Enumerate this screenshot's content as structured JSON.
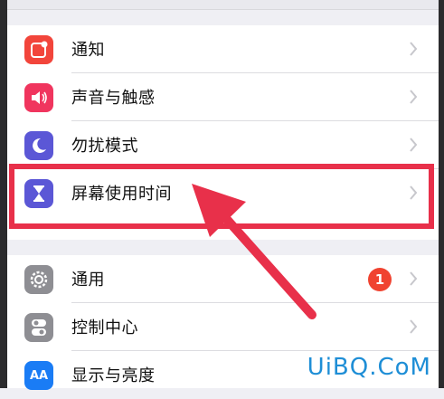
{
  "settings": {
    "group1": [
      {
        "label": "通知",
        "icon": "notifications-icon",
        "color": "#f2453b"
      },
      {
        "label": "声音与触感",
        "icon": "sound-icon",
        "color": "#f0355e"
      },
      {
        "label": "勿扰模式",
        "icon": "moon-icon",
        "color": "#5b57d6"
      },
      {
        "label": "屏幕使用时间",
        "icon": "hourglass-icon",
        "color": "#5b57d6"
      }
    ],
    "group2": [
      {
        "label": "通用",
        "icon": "gear-icon",
        "color": "#8e8e93",
        "badge": "1"
      },
      {
        "label": "控制中心",
        "icon": "toggles-icon",
        "color": "#8e8e93"
      },
      {
        "label": "显示与亮度",
        "icon": "text-size-icon",
        "color": "#1a7cf5",
        "icon_text": "AA"
      }
    ]
  },
  "annotation": {
    "highlight_color": "#e8304a"
  },
  "watermark": "UiBQ.CoM"
}
